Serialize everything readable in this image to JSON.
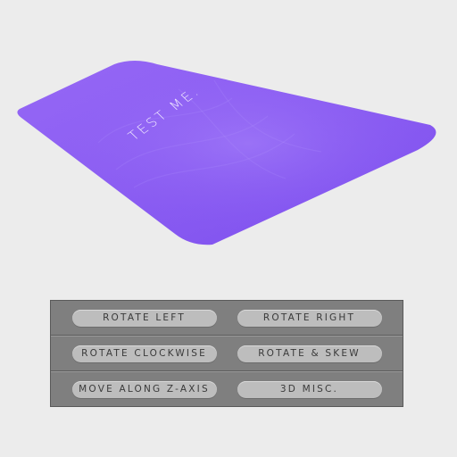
{
  "card": {
    "label": "TEST ME.",
    "color": "#8a5cf2"
  },
  "controls": {
    "rows": [
      {
        "left": "ROTATE LEFT",
        "right": "ROTATE RIGHT"
      },
      {
        "left": "ROTATE CLOCKWISE",
        "right": "ROTATE & SKEW"
      },
      {
        "left": "MOVE ALONG Z-AXIS",
        "right": "3D MISC."
      }
    ]
  }
}
